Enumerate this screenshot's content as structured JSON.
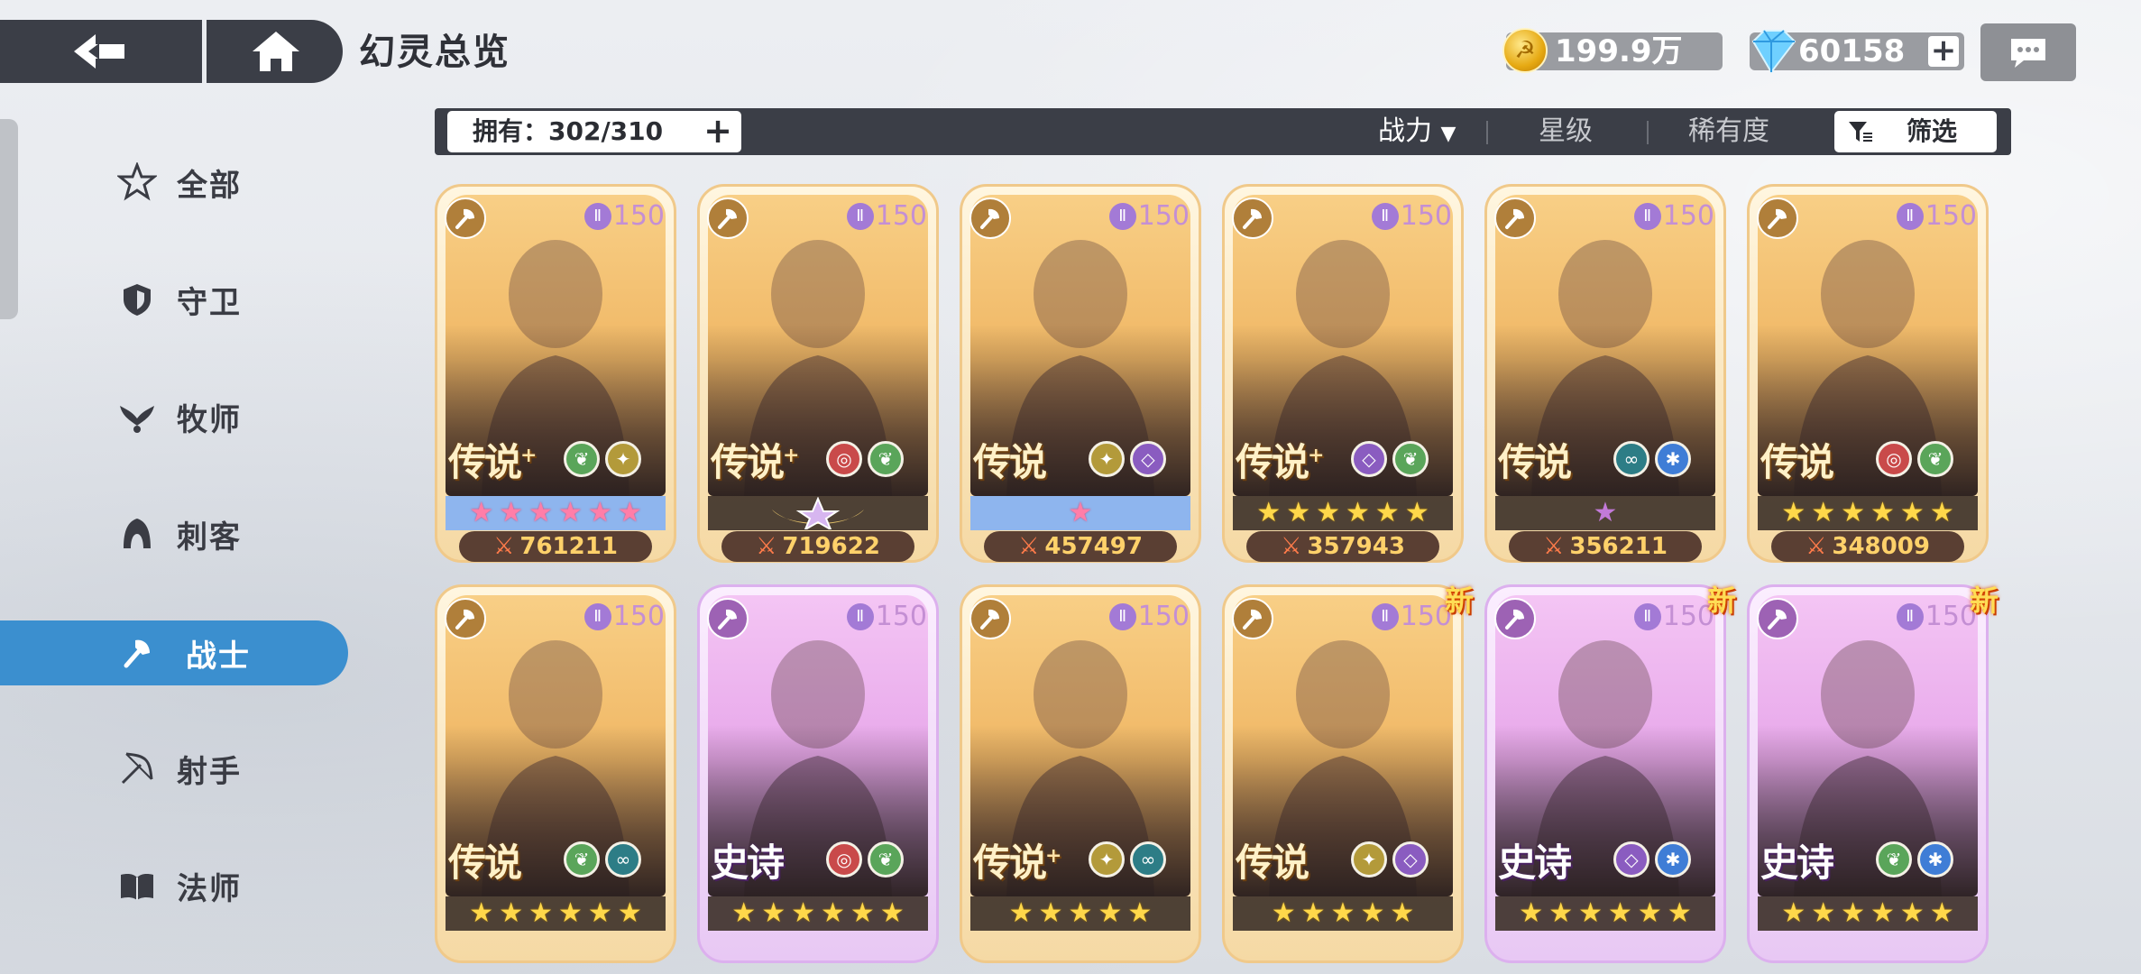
{
  "header": {
    "title": "幻灵总览",
    "gold": "199.9万",
    "gems": "60158"
  },
  "colors": {
    "accent_blue": "#3b8fcf",
    "bar_dark": "#3b3e47",
    "legend_gold": "#f0c98a",
    "epic_purple": "#dcb0ee"
  },
  "sidebar": {
    "items": [
      {
        "label": "全部",
        "icon": "star-all-icon",
        "active": false
      },
      {
        "label": "守卫",
        "icon": "shield-icon",
        "active": false
      },
      {
        "label": "牧师",
        "icon": "wings-icon",
        "active": false
      },
      {
        "label": "刺客",
        "icon": "hood-icon",
        "active": false
      },
      {
        "label": "战士",
        "icon": "axe-icon",
        "active": true
      },
      {
        "label": "射手",
        "icon": "bow-icon",
        "active": false
      },
      {
        "label": "法师",
        "icon": "book-icon",
        "active": false
      }
    ]
  },
  "filterbar": {
    "owned": "拥有：302/310",
    "sort_power": "战力",
    "sort_star": "星级",
    "sort_rarity": "稀有度",
    "filter": "筛选"
  },
  "cards": [
    {
      "rarity": "传说",
      "plus": true,
      "level": "150",
      "elements": [
        "nature-icon",
        "light-icon"
      ],
      "star_style": "blue",
      "star_color": "pink",
      "stars": 6,
      "power": "761211",
      "new": false
    },
    {
      "rarity": "传说",
      "plus": true,
      "level": "150",
      "elements": [
        "swirl-icon",
        "nature-icon"
      ],
      "star_style": "crown",
      "star_color": "purple",
      "stars": 1,
      "power": "719622",
      "new": false
    },
    {
      "rarity": "传说",
      "plus": false,
      "level": "150",
      "elements": [
        "light-icon",
        "void-icon"
      ],
      "star_style": "blue",
      "star_color": "pink",
      "stars": 1,
      "power": "457497",
      "new": false
    },
    {
      "rarity": "传说",
      "plus": true,
      "level": "150",
      "elements": [
        "void-icon",
        "nature-icon"
      ],
      "star_style": "dark",
      "star_color": "yellow",
      "stars": 6,
      "power": "357943",
      "new": false
    },
    {
      "rarity": "传说",
      "plus": false,
      "level": "150",
      "elements": [
        "infinity-icon",
        "frost-icon"
      ],
      "star_style": "dark",
      "star_color": "purple",
      "stars": 1,
      "power": "356211",
      "new": false
    },
    {
      "rarity": "传说",
      "plus": false,
      "level": "150",
      "elements": [
        "swirl-icon",
        "nature-icon"
      ],
      "star_style": "dark",
      "star_color": "yellow",
      "stars": 6,
      "power": "348009",
      "new": false
    },
    {
      "rarity": "传说",
      "plus": false,
      "level": "150",
      "elements": [
        "nature-icon",
        "infinity-icon"
      ],
      "star_style": "dark",
      "star_color": "yellow",
      "stars": 6,
      "power": "",
      "new": false
    },
    {
      "rarity": "史诗",
      "plus": false,
      "level": "150",
      "elements": [
        "swirl-icon",
        "nature-icon"
      ],
      "star_style": "dark",
      "star_color": "yellow",
      "stars": 6,
      "power": "",
      "new": false
    },
    {
      "rarity": "传说",
      "plus": true,
      "level": "150",
      "elements": [
        "light-icon",
        "infinity-icon"
      ],
      "star_style": "dark",
      "star_color": "yellow",
      "stars": 5,
      "power": "",
      "new": false
    },
    {
      "rarity": "传说",
      "plus": false,
      "level": "150",
      "elements": [
        "light-icon",
        "void-icon"
      ],
      "star_style": "dark",
      "star_color": "yellow",
      "stars": 5,
      "power": "",
      "new": true,
      "new_label": "新"
    },
    {
      "rarity": "史诗",
      "plus": false,
      "level": "150",
      "elements": [
        "void-icon",
        "frost-icon"
      ],
      "star_style": "dark",
      "star_color": "yellow",
      "stars": 6,
      "power": "",
      "new": true,
      "new_label": "新"
    },
    {
      "rarity": "史诗",
      "plus": false,
      "level": "150",
      "elements": [
        "nature-icon",
        "frost-icon"
      ],
      "star_style": "dark",
      "star_color": "yellow",
      "stars": 6,
      "power": "",
      "new": true,
      "new_label": "新"
    }
  ]
}
